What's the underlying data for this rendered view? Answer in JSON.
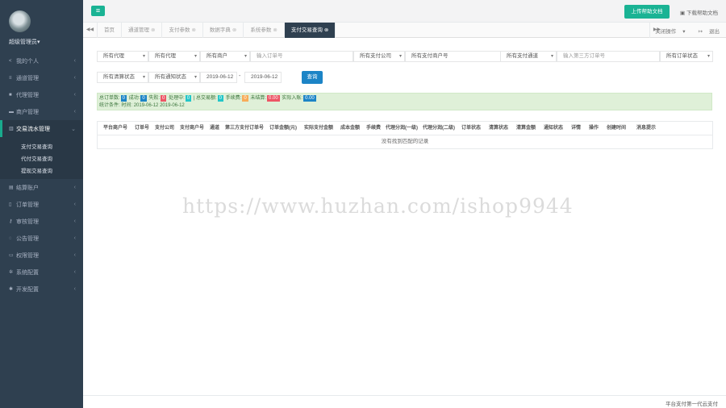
{
  "sidebar": {
    "profile_name": "超级管理员",
    "items": [
      {
        "label": "我的个人",
        "icon": "share-icon"
      },
      {
        "label": "通道管理",
        "icon": "list-icon"
      },
      {
        "label": "代理管理",
        "icon": "book-icon"
      },
      {
        "label": "商户管理",
        "icon": "card-icon"
      },
      {
        "label": "交易流水管理",
        "icon": "chart-icon",
        "active": true
      },
      {
        "label": "结算账户",
        "icon": "bank-icon"
      },
      {
        "label": "订单管理",
        "icon": "doc-icon"
      },
      {
        "label": "审核管理",
        "icon": "key-icon"
      },
      {
        "label": "公告管理",
        "icon": "bell-icon"
      },
      {
        "label": "权限管理",
        "icon": "monitor-icon"
      },
      {
        "label": "系统配置",
        "icon": "gears-icon"
      },
      {
        "label": "开发配置",
        "icon": "cog-icon"
      }
    ],
    "subitems": [
      "支付交易查询",
      "代付交易查询",
      "提现交易查询"
    ]
  },
  "topbar": {
    "help_label": "上传帮助文档",
    "download_label": "下载帮助文档"
  },
  "tabs": {
    "items": [
      "首页",
      "通道管理",
      "支付参数",
      "数据字典",
      "系统参数",
      "支付交易查询"
    ],
    "actions_label": "关闭操作",
    "exit_label": "退出"
  },
  "filters": {
    "channel": "所有代理",
    "agent": "所有代理",
    "merchant": "所有商户",
    "order_placeholder": "输入订单号",
    "company": "所有支付公司",
    "company_merchant": "所有支付商户号",
    "pay_channel": "所有支付通道",
    "third_order_placeholder": "输入第三方订单号",
    "order_status": "所有订单状态",
    "clear_status": "所有清算状态",
    "notify_status": "所有通知状态",
    "date_from": "2019-06-12",
    "date_sep": "-",
    "date_to": "2019-06-12",
    "search_label": "查询"
  },
  "stats": {
    "orders_label": "总订单数:",
    "orders": "0",
    "success_label": "成功:",
    "success": "0",
    "fail_label": "失败:",
    "fail": "0",
    "pending_label": "处理中:",
    "pending": "0",
    "total_label": "| 总交易额:",
    "total": "0",
    "fee_label": "手续费:",
    "fee": "0",
    "settle_label": "未结算:",
    "settle": "0.00",
    "actual_label": "实际入账:",
    "actual": "0.00",
    "time_label": "统计条件: 时间:",
    "time_from": "2019-06-12",
    "time_to": "2019-06-12"
  },
  "table": {
    "headers": [
      "平台商户号",
      "订单号",
      "支付公司",
      "支付商户号",
      "通道",
      "第三方支付订单号",
      "订单金额(元)",
      "实际支付金额",
      "成本金额",
      "手续费",
      "代理分润(一级)",
      "代理分润(二级)",
      "订单状态",
      "清算状态",
      "清算金额",
      "通知状态",
      "详情",
      "操作",
      "创建时间",
      "消息提示"
    ],
    "empty_text": "没有找到匹配的记录"
  },
  "footer": {
    "text": "平台支付第一代云支付"
  },
  "watermark": "https://www.huzhan.com/ishop9944"
}
